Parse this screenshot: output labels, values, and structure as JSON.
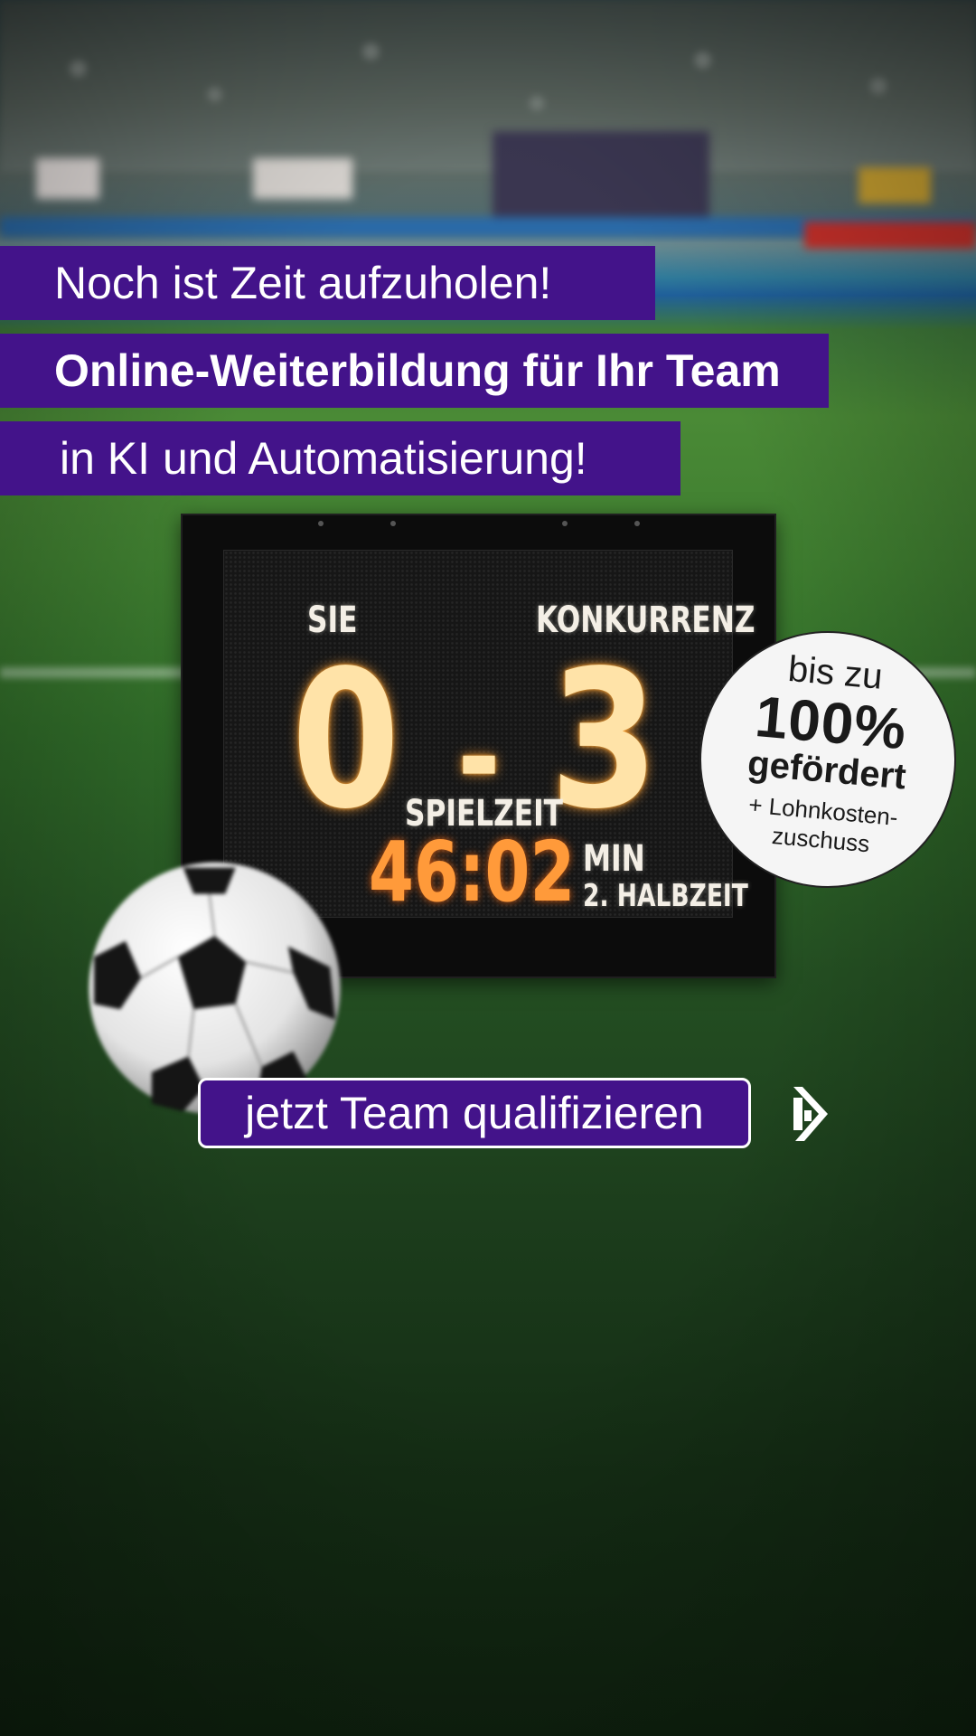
{
  "headline": {
    "line1": "Noch ist Zeit aufzuholen!",
    "line2": "Online-Weiterbildung für Ihr Team",
    "line3": "in KI und Automatisierung!"
  },
  "scoreboard": {
    "left_label": "SIE",
    "right_label": "KONKURRENZ",
    "score_left": "0",
    "score_separator": "-",
    "score_right": "3",
    "time_label": "SPIELZEIT",
    "time": "46:02",
    "time_unit": "MIN",
    "period": "2. HALBZEIT"
  },
  "badge": {
    "line1": "bis zu",
    "line2": "100%",
    "line3": "gefördert",
    "line4": "+ Lohnkosten-",
    "line5": "zuschuss"
  },
  "cta": {
    "label": "jetzt Team qualifizieren"
  },
  "icons": [
    "soccer-ball-icon",
    "brand-logo-icon"
  ],
  "colors": {
    "accent": "#43138a",
    "score_glow": "#ffe3a8",
    "time_orange": "#ff9a3a"
  }
}
